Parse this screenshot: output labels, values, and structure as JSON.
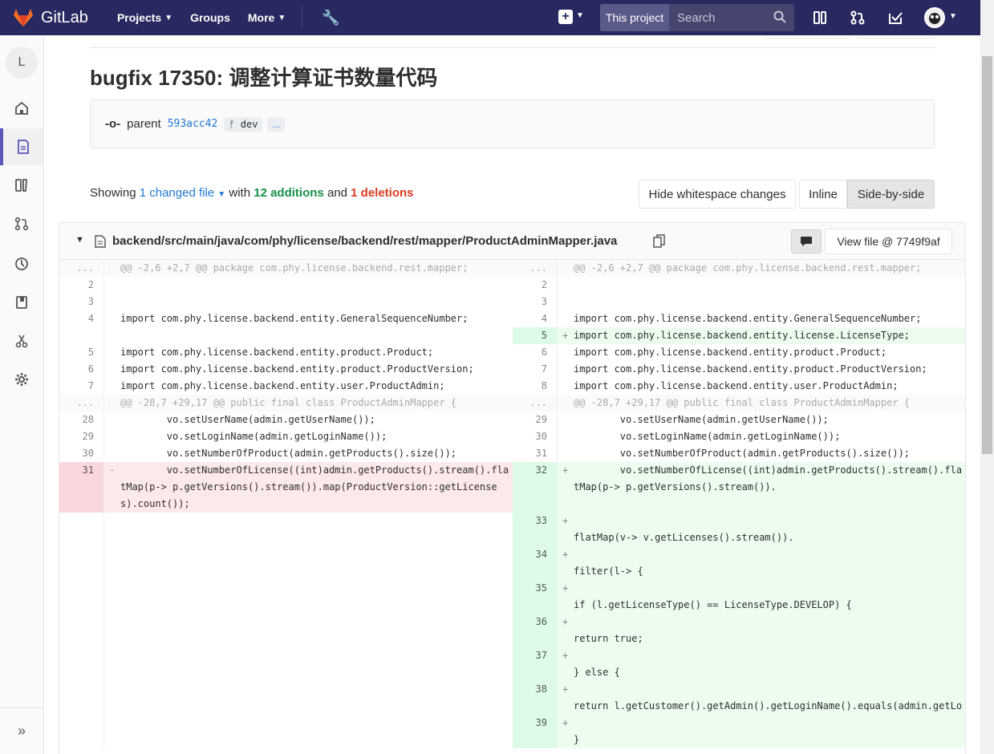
{
  "topbar": {
    "brand": "GitLab",
    "nav": [
      "Projects",
      "Groups",
      "More"
    ],
    "scope_label": "This project",
    "search_placeholder": "Search"
  },
  "sidebar": {
    "project_letter": "L",
    "items": [
      "home-icon",
      "repository-icon",
      "issues-icon",
      "merge-requests-icon",
      "ci-cd-icon",
      "wiki-icon",
      "snippets-icon",
      "settings-icon"
    ]
  },
  "commit": {
    "title": "bugfix 17350: 调整计算证书数量代码",
    "parent_label": "parent",
    "parent_sha": "593acc42",
    "branch": "dev",
    "more": "..."
  },
  "summary": {
    "showing": "Showing",
    "changed": "1 changed file",
    "with": "with",
    "additions": "12 additions",
    "and": "and",
    "deletions": "1 deletions"
  },
  "buttons": {
    "whitespace": "Hide whitespace changes",
    "inline": "Inline",
    "side": "Side-by-side"
  },
  "file": {
    "path": "backend/src/main/java/com/phy/license/backend/rest/mapper/ProductAdminMapper.java",
    "view_file": "View file @ 7749f9af"
  },
  "diff_rows": [
    {
      "type": "match",
      "lnum": "...",
      "lcode": "@@ -2,6 +2,7 @@ package com.phy.license.backend.rest.mapper;",
      "rnum": "...",
      "rcode": "@@ -2,6 +2,7 @@ package com.phy.license.backend.rest.mapper;"
    },
    {
      "type": "ctx",
      "lnum": "2",
      "lcode": "",
      "rnum": "2",
      "rcode": ""
    },
    {
      "type": "ctx",
      "lnum": "3",
      "lcode": "",
      "rnum": "3",
      "rcode": ""
    },
    {
      "type": "ctx",
      "lnum": "4",
      "lcode": "import com.phy.license.backend.entity.GeneralSequenceNumber;",
      "rnum": "4",
      "rcode": "import com.phy.license.backend.entity.GeneralSequenceNumber;"
    },
    {
      "type": "addonly",
      "lnum": "",
      "lcode": "",
      "rnum": "5",
      "rcode": "import com.phy.license.backend.entity.license.LicenseType;"
    },
    {
      "type": "ctx",
      "lnum": "5",
      "lcode": "import com.phy.license.backend.entity.product.Product;",
      "rnum": "6",
      "rcode": "import com.phy.license.backend.entity.product.Product;"
    },
    {
      "type": "ctx",
      "lnum": "6",
      "lcode": "import com.phy.license.backend.entity.product.ProductVersion;",
      "rnum": "7",
      "rcode": "import com.phy.license.backend.entity.product.ProductVersion;"
    },
    {
      "type": "ctx",
      "lnum": "7",
      "lcode": "import com.phy.license.backend.entity.user.ProductAdmin;",
      "rnum": "8",
      "rcode": "import com.phy.license.backend.entity.user.ProductAdmin;"
    },
    {
      "type": "match",
      "lnum": "...",
      "lcode": "@@ -28,7 +29,17 @@ public final class ProductAdminMapper {",
      "rnum": "...",
      "rcode": "@@ -28,7 +29,17 @@ public final class ProductAdminMapper {"
    },
    {
      "type": "ctx",
      "lnum": "28",
      "lcode": "        vo.setUserName(admin.getUserName());",
      "rnum": "29",
      "rcode": "        vo.setUserName(admin.getUserName());"
    },
    {
      "type": "ctx",
      "lnum": "29",
      "lcode": "        vo.setLoginName(admin.getLoginName());",
      "rnum": "30",
      "rcode": "        vo.setLoginName(admin.getLoginName());"
    },
    {
      "type": "ctx",
      "lnum": "30",
      "lcode": "        vo.setNumberOfProduct(admin.getProducts().size());",
      "rnum": "31",
      "rcode": "        vo.setNumberOfProduct(admin.getProducts().size());"
    },
    {
      "type": "change",
      "lnum": "31",
      "lcode": "        vo.setNumberOfLicense((int)admin.getProducts().stream().flatMap(p-> p.getVersions().stream()).map(ProductVersion::getLicenses).count());",
      "rnum": "32",
      "rcode": "        vo.setNumberOfLicense((int)admin.getProducts().stream().flatMap(p-> p.getVersions().stream())."
    },
    {
      "type": "addonly2",
      "lnum": "",
      "lcode": "",
      "rnum": "33",
      "rcode": "flatMap(v-> v.getLicenses().stream())."
    },
    {
      "type": "addonly2",
      "lnum": "",
      "lcode": "",
      "rnum": "34",
      "rcode": "filter(l-> {"
    },
    {
      "type": "addonly2",
      "lnum": "",
      "lcode": "",
      "rnum": "35",
      "rcode": "if (l.getLicenseType() == LicenseType.DEVELOP) {"
    },
    {
      "type": "addonly2",
      "lnum": "",
      "lcode": "",
      "rnum": "36",
      "rcode": "return true;"
    },
    {
      "type": "addonly2",
      "lnum": "",
      "lcode": "",
      "rnum": "37",
      "rcode": "} else {"
    },
    {
      "type": "addonly2",
      "lnum": "",
      "lcode": "",
      "rnum": "38",
      "rcode": "return l.getCustomer().getAdmin().getLoginName().equals(admin.getLoginName());"
    },
    {
      "type": "addonly2",
      "lnum": "",
      "lcode": "",
      "rnum": "39",
      "rcode": "}"
    }
  ]
}
